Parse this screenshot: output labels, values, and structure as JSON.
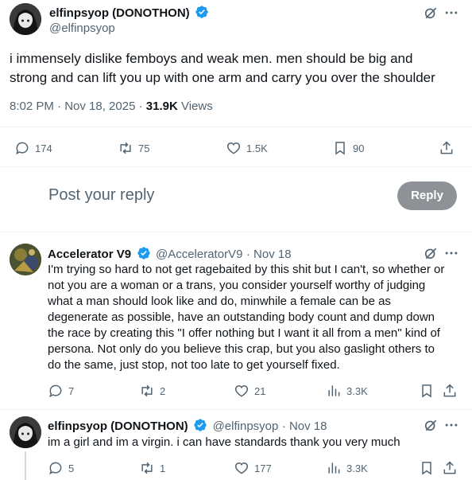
{
  "main_tweet": {
    "display_name": "elfinpsyop (DONOTHON)",
    "handle": "@elfinpsyop",
    "text_line1": "i immensely dislike femboys and weak men. men should be big and",
    "text_line2": "strong and can lift you up with one arm and carry you over the shoulder",
    "timestamp": "8:02 PM · Nov 18, 2025 · ",
    "views_count": "31.9K",
    "views_label": " Views",
    "actions": {
      "replies": "174",
      "reposts": "75",
      "likes": "1.5K",
      "bookmarks": "90"
    }
  },
  "composer": {
    "placeholder": "Post your reply",
    "button_label": "Reply"
  },
  "replies": [
    {
      "display_name": "Accelerator V9",
      "handle": "@AcceleratorV9",
      "date": "· Nov 18",
      "lines": [
        "I'm trying so hard to not get ragebaited by this shit but I can't, so whether or",
        "not you are a woman or a trans, you consider yourself worthy of judging",
        "what a man should look like and do, minwhile a female can be as",
        "degenerate as possible, have an outstanding body count and dump down",
        "the race by creating this \"I offer nothing but I want it all from a men\" kind of",
        "persona. Not only do you believe this crap, but you also gaslight others to",
        "do the same, just stop, not too late to get yourself fixed."
      ],
      "replies": "7",
      "reposts": "2",
      "likes": "21",
      "views": "3.3K"
    },
    {
      "display_name": "elfinpsyop (DONOTHON)",
      "handle": "@elfinpsyop",
      "date": "· Nov 18",
      "lines": [
        "im a girl and im a virgin. i can have standards thank you very much"
      ],
      "replies": "5",
      "reposts": "1",
      "likes": "177",
      "views": "3.3K"
    }
  ],
  "colors": {
    "text": "#0f1419",
    "secondary": "#536471",
    "verified": "#1d9bf0",
    "reply_button": "#8e9296",
    "divider": "#eff3f4"
  }
}
